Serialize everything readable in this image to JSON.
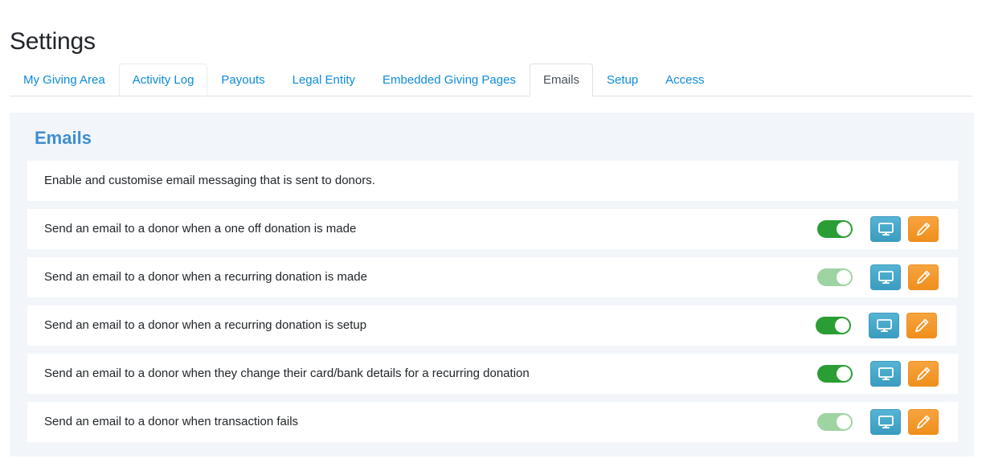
{
  "page": {
    "title": "Settings"
  },
  "tabs": [
    {
      "label": "My Giving Area",
      "state": "default",
      "name": "tab-my-giving-area"
    },
    {
      "label": "Activity Log",
      "state": "hovered",
      "name": "tab-activity-log"
    },
    {
      "label": "Payouts",
      "state": "default",
      "name": "tab-payouts"
    },
    {
      "label": "Legal Entity",
      "state": "default",
      "name": "tab-legal-entity"
    },
    {
      "label": "Embedded Giving Pages",
      "state": "default",
      "name": "tab-embedded-giving-pages"
    },
    {
      "label": "Emails",
      "state": "active",
      "name": "tab-emails"
    },
    {
      "label": "Setup",
      "state": "default",
      "name": "tab-setup"
    },
    {
      "label": "Access",
      "state": "default",
      "name": "tab-access"
    }
  ],
  "panel": {
    "heading": "Emails",
    "description": "Enable and customise email messaging that is sent to donors."
  },
  "email_settings": [
    {
      "label": "Send an email to a donor when a one off donation is made",
      "enabled": true,
      "toggle_state": "on",
      "preview_label": "Preview",
      "edit_label": "Edit"
    },
    {
      "label": "Send an email to a donor when a recurring donation is made",
      "enabled": true,
      "toggle_state": "on-muted",
      "preview_label": "Preview",
      "edit_label": "Edit"
    },
    {
      "label": "Send an email to a donor when a recurring donation is setup",
      "enabled": true,
      "toggle_state": "on",
      "preview_label": "Preview",
      "edit_label": "Edit"
    },
    {
      "label": "Send an email to a donor when they change their card/bank details for a recurring donation",
      "enabled": true,
      "toggle_state": "on",
      "preview_label": "Preview",
      "edit_label": "Edit"
    },
    {
      "label": "Send an email to a donor when transaction fails",
      "enabled": true,
      "toggle_state": "on-muted",
      "preview_label": "Preview",
      "edit_label": "Edit"
    }
  ],
  "icons": {
    "preview": "monitor-icon",
    "edit": "pencil-icon"
  },
  "colors": {
    "link": "#0d8bd9",
    "heading": "#3f8ed0",
    "panel_bg": "#f2f6fb",
    "toggle_on": "#2a9d34",
    "toggle_on_muted": "#9ed3a2",
    "preview_button": "#3a9cc0",
    "edit_button": "#ef8f1c",
    "text": "#212529",
    "tab_active_text": "#495057",
    "border": "#dee2e6"
  }
}
